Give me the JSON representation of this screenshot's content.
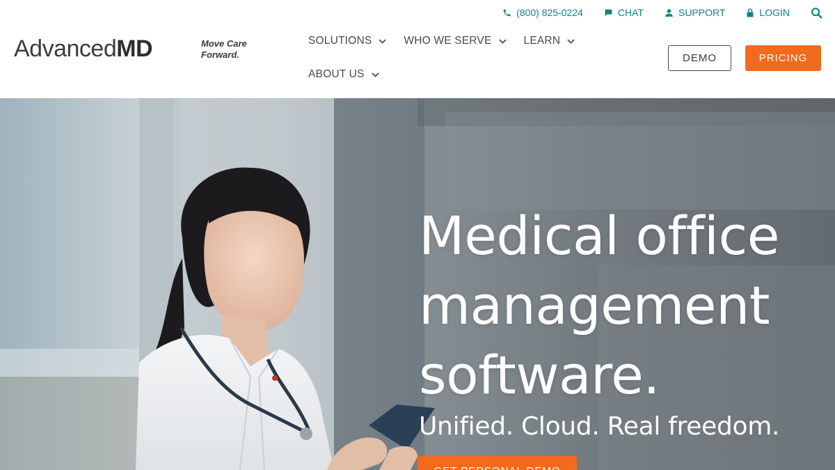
{
  "utility": {
    "phone": "(800) 825-0224",
    "chat": "CHAT",
    "support": "SUPPORT",
    "login": "LOGIN"
  },
  "brand": {
    "logo_regular": "Advanced",
    "logo_bold": "MD",
    "tagline_line1": "Move Care",
    "tagline_line2": "Forward."
  },
  "nav": {
    "items": [
      {
        "label": "SOLUTIONS"
      },
      {
        "label": "WHO WE SERVE"
      },
      {
        "label": "LEARN"
      },
      {
        "label": "ABOUT US"
      }
    ]
  },
  "header_buttons": {
    "demo": "DEMO",
    "pricing": "PRICING"
  },
  "hero": {
    "title_line1": "Medical office",
    "title_line2": "management",
    "title_line3": "software.",
    "subtitle": "Unified. Cloud. Real freedom.",
    "cta": "GET PERSONAL DEMO"
  },
  "colors": {
    "teal": "#0d8480",
    "orange": "#f26b1d",
    "text_dark": "#3a3a3a"
  },
  "icons": [
    "phone-icon",
    "chat-icon",
    "support-icon",
    "lock-icon",
    "search-icon",
    "chevron-down-icon"
  ]
}
